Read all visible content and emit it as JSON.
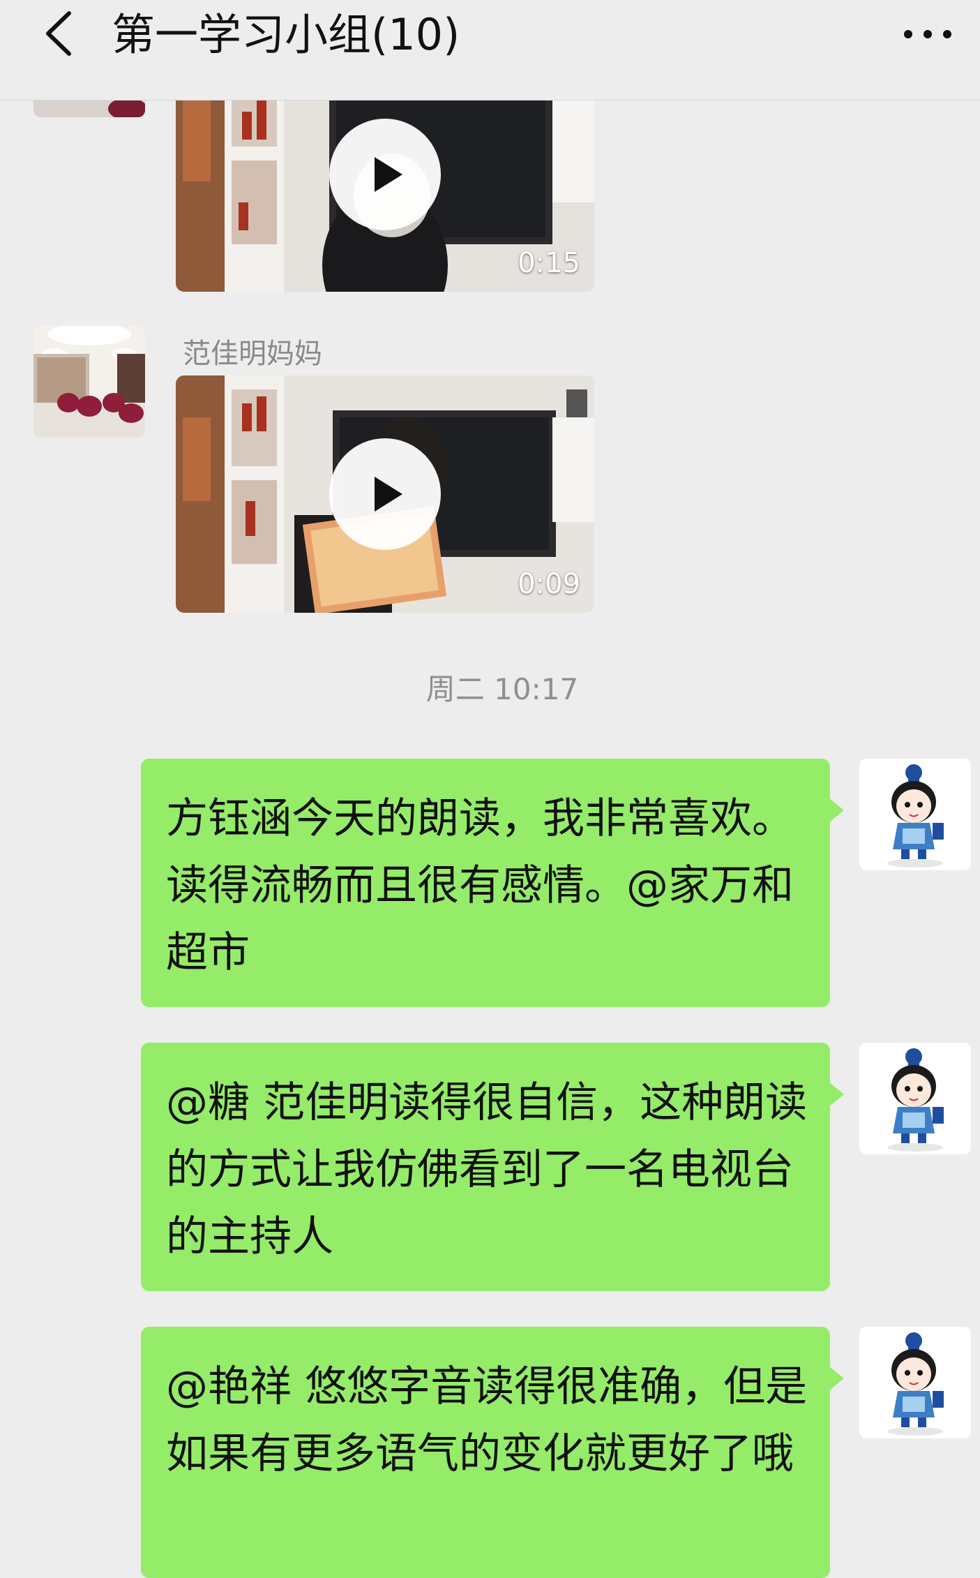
{
  "header": {
    "title": "第一学习小组(10)",
    "back_icon": "chevron-left-icon",
    "more_icon": "more-dots-icon"
  },
  "messages": {
    "video1": {
      "duration": "0:15"
    },
    "video2": {
      "sender": "范佳明妈妈",
      "duration": "0:09"
    },
    "timestamp": "周二 10:17",
    "texts": [
      "方钰涵今天的朗读，我非常喜欢。读得流畅而且很有感情。@家万和超市",
      "@糖 范佳明读得很自信，这种朗读的方式让我仿佛看到了一名电视台的主持人",
      "@艳祥 悠悠字音读得很准确，但是如果有更多语气的变化就更好了哦"
    ]
  },
  "colors": {
    "background": "#ededed",
    "bubble_green": "#95ec69",
    "meta_gray": "#8f8f8f"
  }
}
